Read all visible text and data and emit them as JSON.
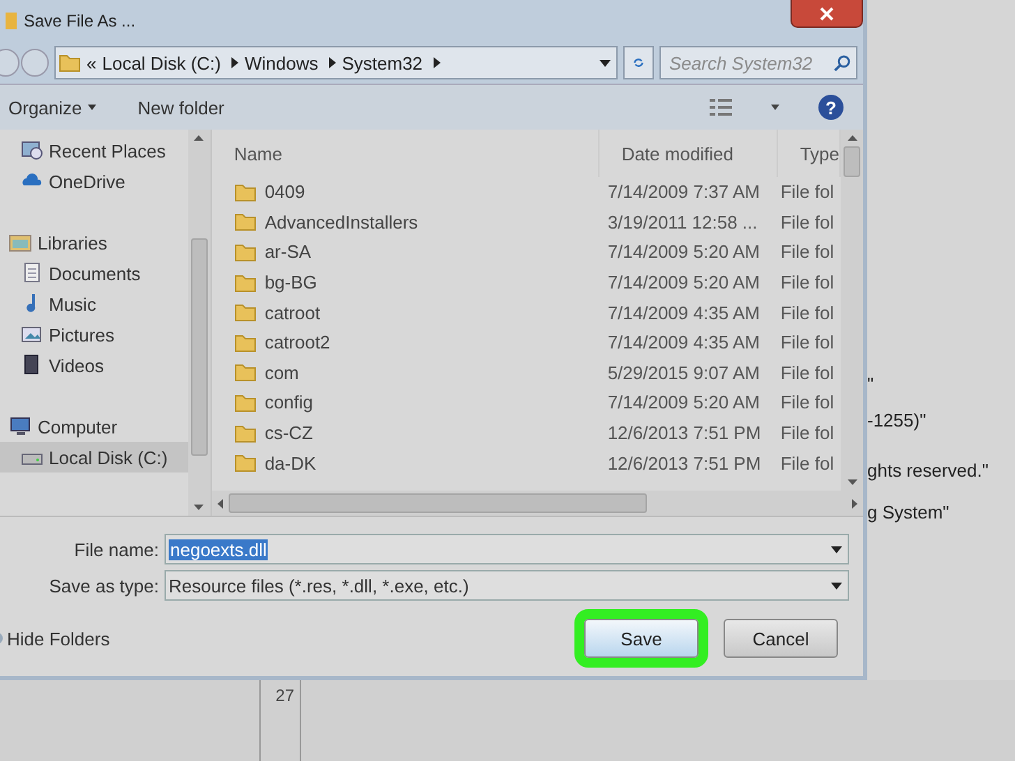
{
  "window": {
    "title": "Save File As ..."
  },
  "address_bar": {
    "overflow": "«",
    "crumbs": [
      "Local Disk (C:)",
      "Windows",
      "System32"
    ]
  },
  "search": {
    "placeholder": "Search System32"
  },
  "toolbar": {
    "organize": "Organize",
    "new_folder": "New folder",
    "help": "?"
  },
  "sidebar": {
    "sections": [
      {
        "items": [
          {
            "label": "Recent Places",
            "kind": "recent",
            "selected": false
          },
          {
            "label": "OneDrive",
            "kind": "cloud",
            "selected": false
          }
        ]
      },
      {
        "label": "Libraries",
        "kind": "libraries",
        "items": [
          {
            "label": "Documents",
            "kind": "documents",
            "selected": false
          },
          {
            "label": "Music",
            "kind": "music",
            "selected": false
          },
          {
            "label": "Pictures",
            "kind": "pictures",
            "selected": false
          },
          {
            "label": "Videos",
            "kind": "videos",
            "selected": false
          }
        ]
      },
      {
        "label": "Computer",
        "kind": "computer",
        "items": [
          {
            "label": "Local Disk (C:)",
            "kind": "disk",
            "selected": true
          }
        ]
      }
    ]
  },
  "table": {
    "columns": [
      "Name",
      "Date modified",
      "Type"
    ],
    "rows": [
      {
        "name": "0409",
        "date": "7/14/2009 7:37 AM",
        "type": "File fol"
      },
      {
        "name": "AdvancedInstallers",
        "date": "3/19/2011 12:58 ...",
        "type": "File fol"
      },
      {
        "name": "ar-SA",
        "date": "7/14/2009 5:20 AM",
        "type": "File fol"
      },
      {
        "name": "bg-BG",
        "date": "7/14/2009 5:20 AM",
        "type": "File fol"
      },
      {
        "name": "catroot",
        "date": "7/14/2009 4:35 AM",
        "type": "File fol"
      },
      {
        "name": "catroot2",
        "date": "7/14/2009 4:35 AM",
        "type": "File fol"
      },
      {
        "name": "com",
        "date": "5/29/2015 9:07 AM",
        "type": "File fol"
      },
      {
        "name": "config",
        "date": "7/14/2009 5:20 AM",
        "type": "File fol"
      },
      {
        "name": "cs-CZ",
        "date": "12/6/2013 7:51 PM",
        "type": "File fol"
      },
      {
        "name": "da-DK",
        "date": "12/6/2013 7:51 PM",
        "type": "File fol"
      }
    ]
  },
  "form": {
    "file_name": {
      "label": "File name:",
      "value": "negoexts.dll"
    },
    "save_as_type": {
      "label": "Save as type:",
      "value": "Resource files (*.res, *.dll, *.exe, etc.)"
    }
  },
  "hide_folders": "Hide Folders",
  "buttons": [
    {
      "label": "Save",
      "highlighted": true
    },
    {
      "label": "Cancel",
      "highlighted": false
    }
  ],
  "background_window": {
    "lines": [
      "\"",
      "-1255)\"",
      "ghts reserved.\"",
      "g System\""
    ],
    "line_number": "27"
  }
}
